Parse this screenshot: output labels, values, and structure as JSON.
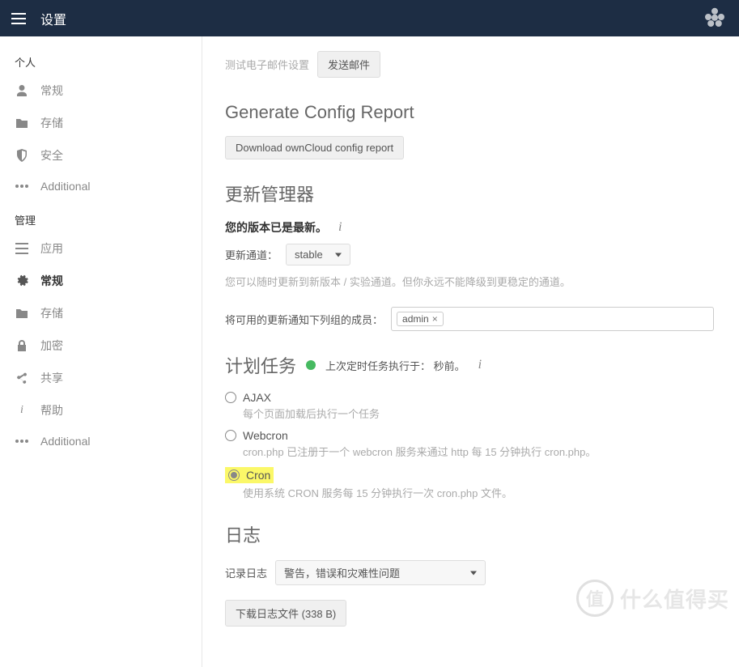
{
  "topbar": {
    "title": "设置"
  },
  "sidebar": {
    "section_personal": "个人",
    "section_admin": "管理",
    "personal": [
      {
        "label": "常规",
        "icon": "user"
      },
      {
        "label": "存储",
        "icon": "folder"
      },
      {
        "label": "安全",
        "icon": "shield"
      },
      {
        "label": "Additional",
        "icon": "dots"
      }
    ],
    "admin": [
      {
        "label": "应用",
        "icon": "list"
      },
      {
        "label": "常规",
        "icon": "gear",
        "active": true
      },
      {
        "label": "存储",
        "icon": "folder"
      },
      {
        "label": "加密",
        "icon": "lock"
      },
      {
        "label": "共享",
        "icon": "share"
      },
      {
        "label": "帮助",
        "icon": "info"
      },
      {
        "label": "Additional",
        "icon": "dots"
      }
    ]
  },
  "email": {
    "test_label": "测试电子邮件设置",
    "send_button": "发送邮件"
  },
  "config": {
    "title": "Generate Config Report",
    "download_button": "Download ownCloud config report"
  },
  "updater": {
    "title": "更新管理器",
    "status": "您的版本已是最新。",
    "channel_label": "更新通道：",
    "channel_value": "stable",
    "hint": "您可以随时更新到新版本 / 实验通道。但你永远不能降级到更稳定的通道。",
    "notify_label": "将可用的更新通知下列组的成员：",
    "notify_tag": "admin"
  },
  "cron": {
    "title": "计划任务",
    "last_run_prefix": "上次定时任务执行于：",
    "last_run_value": "秒前。",
    "options": {
      "ajax": {
        "label": "AJAX",
        "desc": "每个页面加载后执行一个任务"
      },
      "webcron": {
        "label": "Webcron",
        "desc": "cron.php 已注册于一个 webcron 服务来通过 http 每 15 分钟执行 cron.php。"
      },
      "cron": {
        "label": "Cron",
        "desc": "使用系统 CRON 服务每 15 分钟执行一次 cron.php 文件。"
      }
    }
  },
  "log": {
    "title": "日志",
    "level_label": "记录日志",
    "level_value": "警告，错误和灾难性问题",
    "download_button": "下载日志文件 (338 B)"
  },
  "watermark": {
    "text": "什么值得买"
  }
}
